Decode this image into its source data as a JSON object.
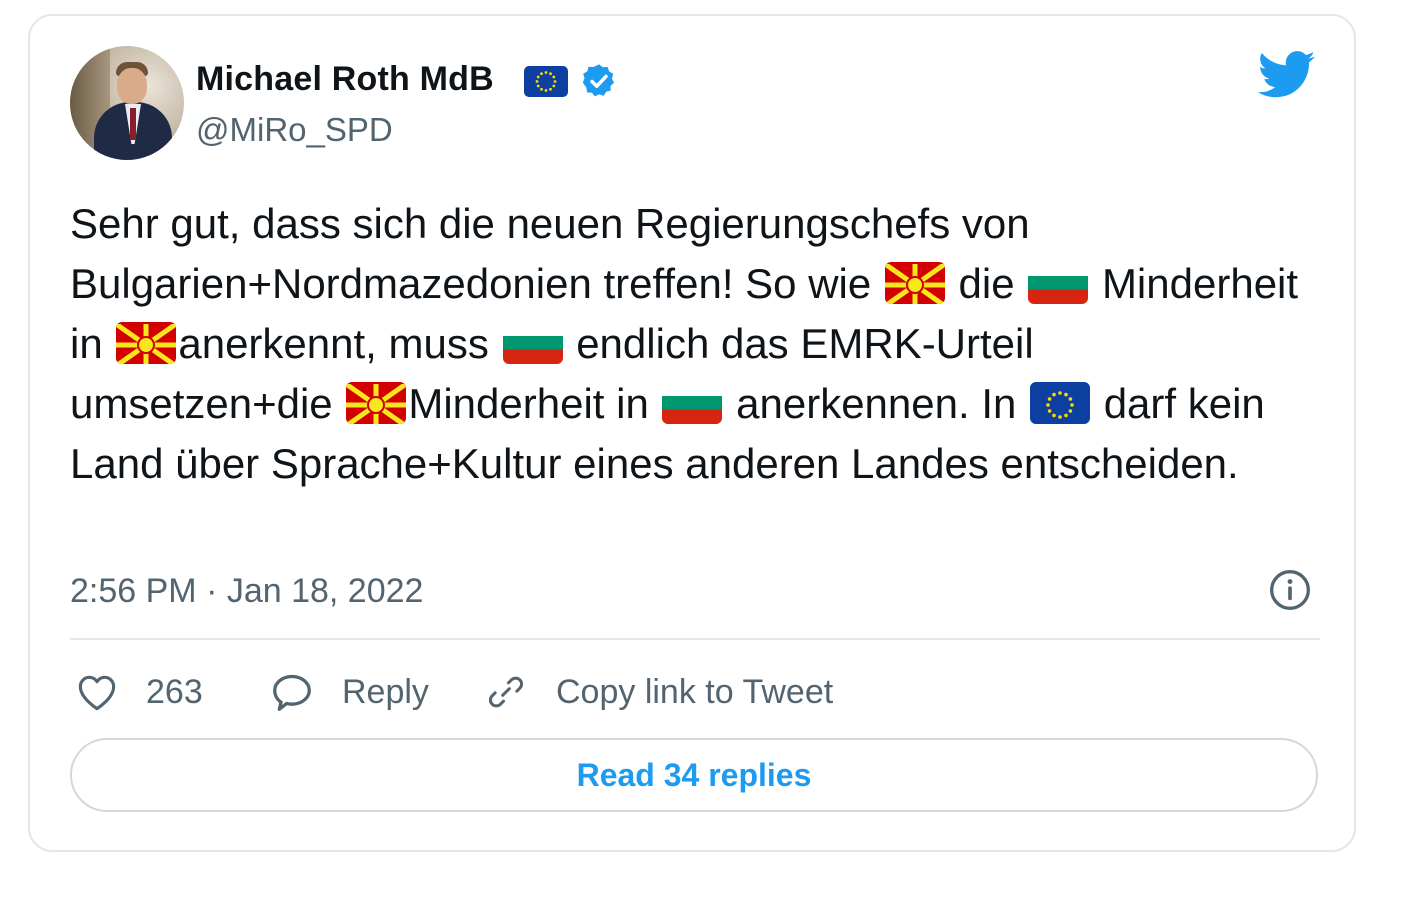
{
  "author": {
    "name": "Michael Roth MdB",
    "handle": "@MiRo_SPD",
    "name_flag_icon": "eu-flag-icon",
    "verified_icon": "verified-badge-icon"
  },
  "tweet": {
    "segments": {
      "s1": "Sehr gut, dass sich die neuen Regierungschefs von Bulgarien+Nordmazedonien treffen! So wie ",
      "s2": " die ",
      "s3": " Minderheit in ",
      "s4": "anerkennt, muss ",
      "s5": " endlich das EMRK-Urteil umsetzen+die ",
      "s6": "Minderheit in ",
      "s7": " anerkennen. In ",
      "s8": " darf kein Land über Sprache+Kultur eines anderen Landes entscheiden."
    },
    "timestamp": "2:56 PM · Jan 18, 2022"
  },
  "actions": {
    "like_count": "263",
    "reply_label": "Reply",
    "copy_label": "Copy link to Tweet"
  },
  "read_replies_label": "Read 34 replies",
  "colors": {
    "accent": "#1d9bf0",
    "verified": "#1d9bf0",
    "secondary_text": "#536471",
    "border": "#e1e8ed"
  }
}
